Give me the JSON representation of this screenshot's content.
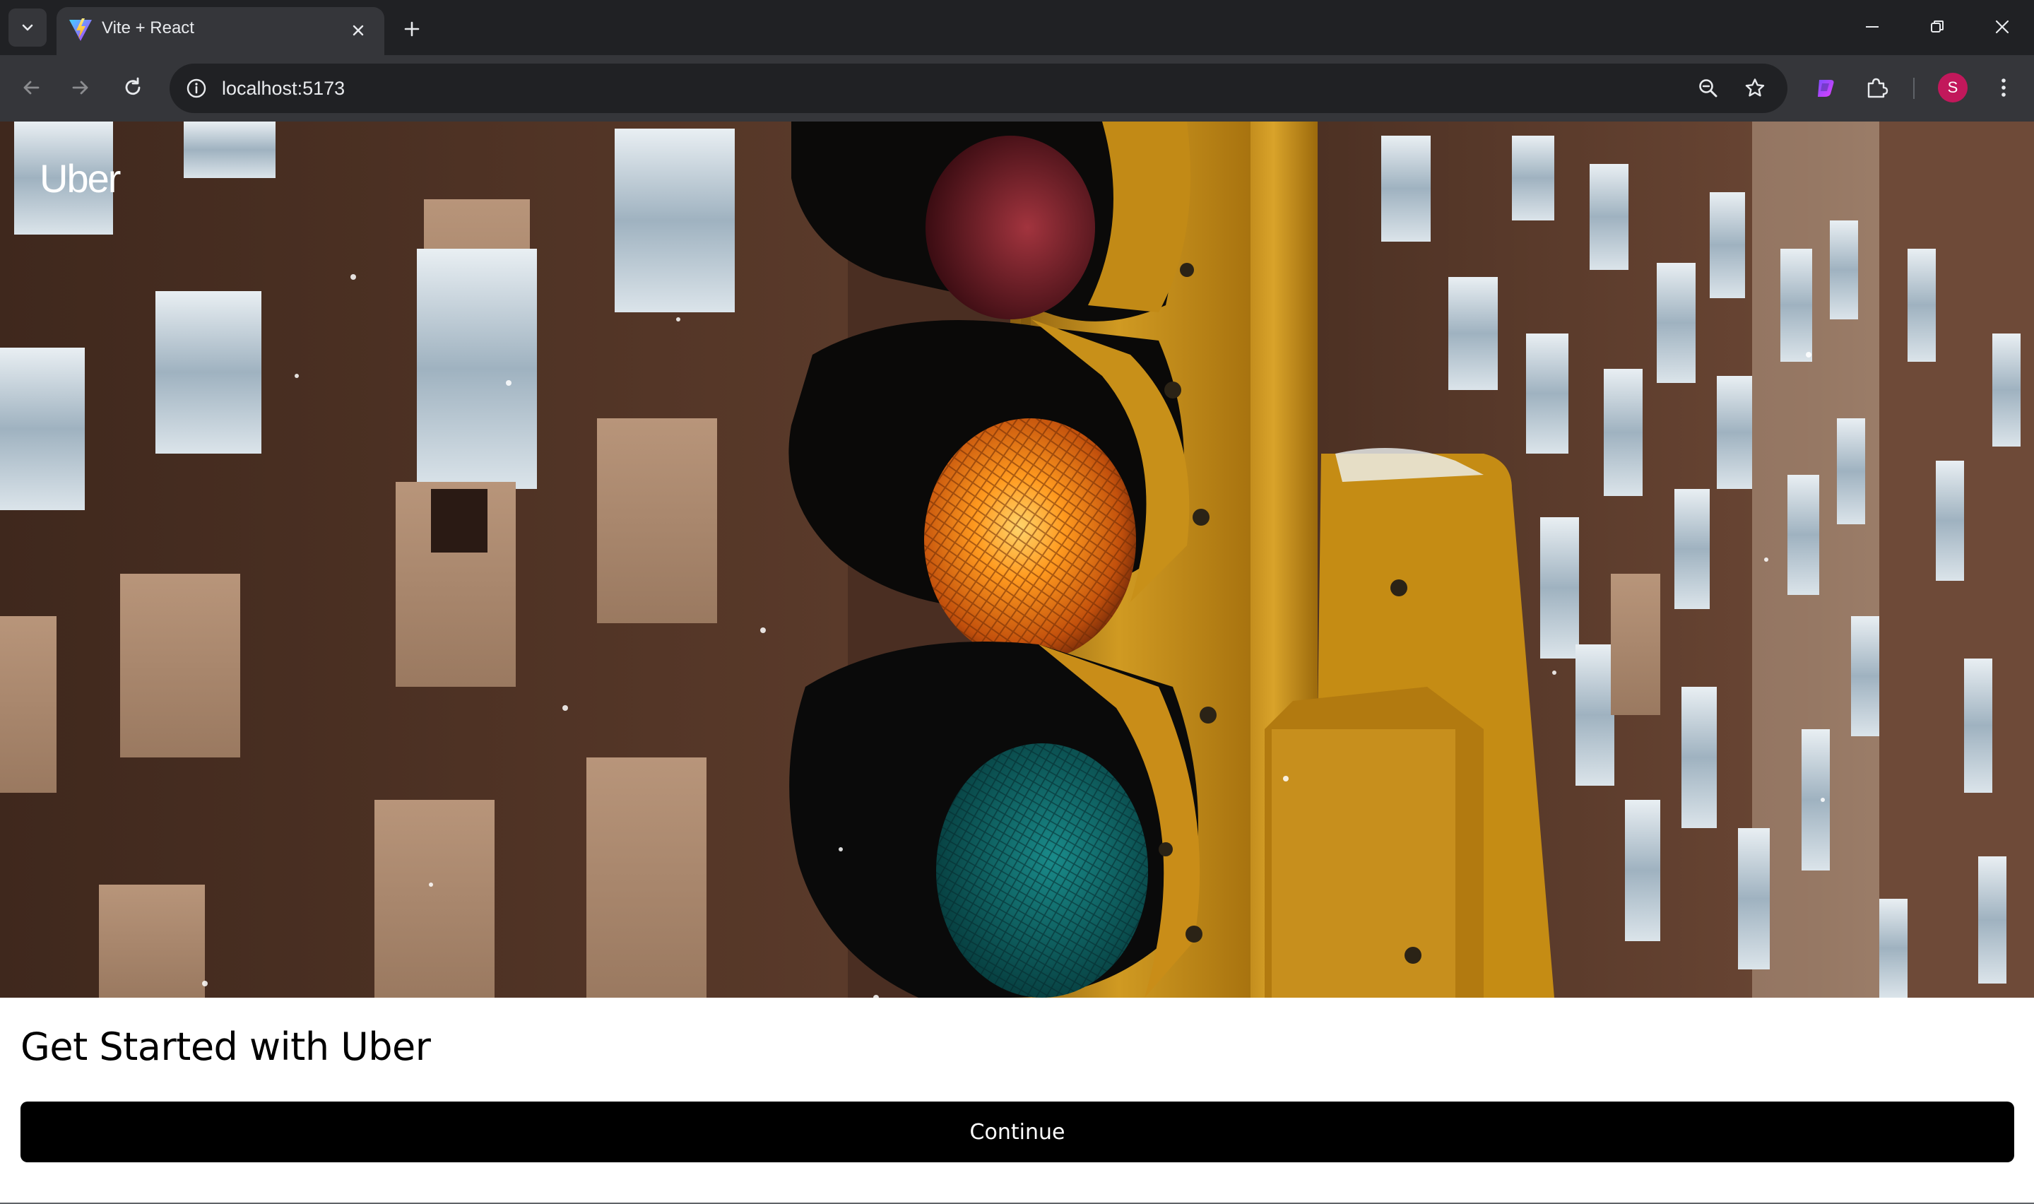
{
  "browser": {
    "tab": {
      "title": "Vite + React"
    },
    "address_bar": {
      "url": "localhost:5173"
    },
    "profile": {
      "initial": "S",
      "color": "#c2185b"
    },
    "icons": {
      "tab_search": "chevron-down-icon",
      "tab_close": "close-icon",
      "new_tab": "plus-icon",
      "minimize": "minimize-icon",
      "restore": "restore-icon",
      "close_window": "close-icon",
      "back": "arrow-left-icon",
      "forward": "arrow-right-icon",
      "reload": "reload-icon",
      "site_info": "info-icon",
      "zoom": "zoom-icon",
      "bookmark": "star-icon",
      "extension": "puzzle-icon",
      "menu": "kebab-menu-icon"
    }
  },
  "page": {
    "logo": "Uber",
    "hero": {
      "subject": "traffic-light-image"
    },
    "title": "Get Started with Uber",
    "continue_button": "Continue"
  },
  "colors": {
    "chrome_dark": "#202124",
    "chrome_mid": "#35363a",
    "button_bg": "#000000",
    "button_text": "#ffffff",
    "signal_amber": "#ff8c1a",
    "signal_green": "#0f6f6f",
    "signal_red": "#7a1a24",
    "housing_yellow": "#c98d18"
  }
}
